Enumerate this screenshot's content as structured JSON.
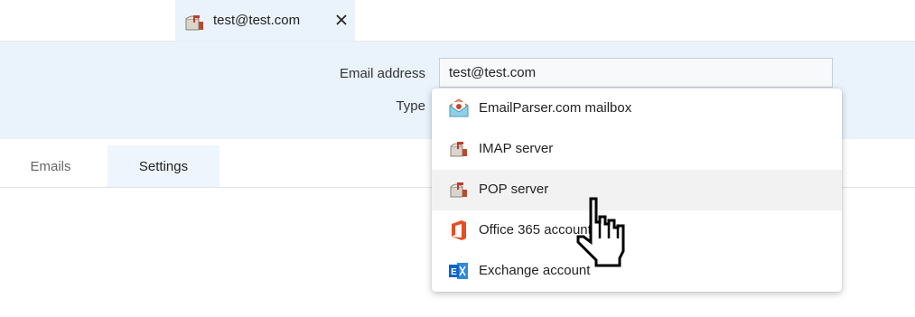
{
  "tab": {
    "title": "test@test.com",
    "icon": "mailbox-icon",
    "close_icon": "close-icon"
  },
  "form": {
    "email_label": "Email address",
    "email_value": "test@test.com",
    "type_label": "Type"
  },
  "tabs": [
    {
      "label": "Emails",
      "active": false
    },
    {
      "label": "Settings",
      "active": true
    }
  ],
  "dropdown": {
    "options": [
      {
        "label": "EmailParser.com mailbox",
        "icon": "emailparser-icon"
      },
      {
        "label": "IMAP server",
        "icon": "mailbox-icon"
      },
      {
        "label": "POP server",
        "icon": "mailbox-icon",
        "highlighted": true
      },
      {
        "label": "Office 365 account",
        "icon": "office365-icon"
      },
      {
        "label": "Exchange account",
        "icon": "exchange-icon"
      }
    ]
  },
  "colors": {
    "panel_bg": "#eaf3fc",
    "office_orange": "#e84c22",
    "exchange_blue": "#0a64c8"
  }
}
